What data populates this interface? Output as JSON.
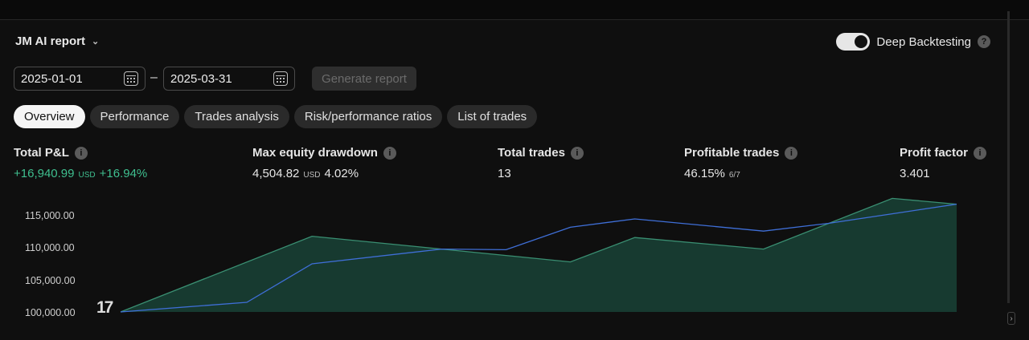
{
  "report": {
    "title": "JM AI report"
  },
  "deep_backtesting": {
    "label": "Deep Backtesting",
    "enabled": true,
    "help": "?"
  },
  "dates": {
    "start": "2025-01-01",
    "end": "2025-03-31",
    "separator": "–"
  },
  "generate_button": "Generate report",
  "tabs": [
    "Overview",
    "Performance",
    "Trades analysis",
    "Risk/performance ratios",
    "List of trades"
  ],
  "active_tab": "Overview",
  "metrics": {
    "total_pnl": {
      "label": "Total P&L",
      "value": "+16,940.99",
      "unit": "USD",
      "pct": "+16.94%"
    },
    "max_dd": {
      "label": "Max equity drawdown",
      "value": "4,504.82",
      "unit": "USD",
      "pct": "4.02%"
    },
    "total_trades": {
      "label": "Total trades",
      "value": "13"
    },
    "profitable": {
      "label": "Profitable trades",
      "value": "46.15%",
      "ratio": "6/7"
    },
    "profit_factor": {
      "label": "Profit factor",
      "value": "3.401"
    }
  },
  "logo": "17",
  "colors": {
    "equity": "#3a8f72",
    "buyhold": "#3f6fd8",
    "fill": "#173a30"
  },
  "chart_data": {
    "type": "area",
    "y_ticks": [
      "115,000.00",
      "110,000.00",
      "105,000.00",
      "100,000.00"
    ],
    "ylim": [
      100000,
      115000
    ],
    "series": [
      {
        "values": [
          100000,
          111800,
          108800,
          107800,
          111600,
          109800,
          117700,
          116800
        ]
      },
      {
        "values": [
          100000,
          101500,
          107500,
          109800,
          109700,
          113200,
          114500,
          112600,
          113800,
          115300,
          116800
        ]
      }
    ],
    "x_positions_equity": [
      0,
      1,
      2,
      3,
      4,
      5,
      6,
      7
    ],
    "x_positions_buyhold": [
      0,
      1,
      2,
      3,
      4,
      5,
      6,
      7,
      8,
      9,
      10
    ]
  }
}
